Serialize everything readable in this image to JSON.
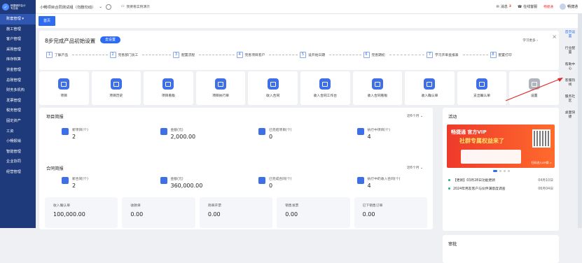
{
  "sidebar": {
    "logo_line1": "畅捷通好会计",
    "logo_line2": "专业版",
    "items": [
      {
        "label": "账套管理 ▾",
        "active": true
      },
      {
        "label": "施工管理",
        "active": false
      },
      {
        "label": "客户管理",
        "active": false
      },
      {
        "label": "采购管理",
        "active": false
      },
      {
        "label": "库存核算",
        "active": false
      },
      {
        "label": "资金管理",
        "active": false
      },
      {
        "label": "总账管理",
        "active": false
      },
      {
        "label": "财务多机构",
        "active": false
      },
      {
        "label": "发票管理",
        "active": false
      },
      {
        "label": "税务管理",
        "active": false
      },
      {
        "label": "固定资产",
        "active": false
      },
      {
        "label": "工资",
        "active": false
      },
      {
        "label": "小畅报销",
        "active": false
      },
      {
        "label": "智能管理",
        "active": false
      },
      {
        "label": "企业协同",
        "active": false
      },
      {
        "label": "经营管理",
        "active": false
      }
    ]
  },
  "topbar": {
    "company": "小畅项目合同测试组（勿删勿动）",
    "demo": "我要看实例演示",
    "message": "消息",
    "message_count": "3",
    "service": "在线客服",
    "brand": "畅捷通",
    "user": "畅捷通"
  },
  "tabs": [
    {
      "label": "首页"
    }
  ],
  "setup": {
    "title": "8步完成产品初始设置",
    "button": "去设置",
    "more": "学习更多 ›",
    "steps": [
      {
        "num": "1",
        "label": "了解产品"
      },
      {
        "num": "2",
        "label": "完善部门员工"
      },
      {
        "num": "3",
        "label": "配置流程"
      },
      {
        "num": "4",
        "label": "完善项目客户"
      },
      {
        "num": "5",
        "label": "设开始日期"
      },
      {
        "num": "6",
        "label": "完善期初"
      },
      {
        "num": "7",
        "label": "学习开单查报表"
      },
      {
        "num": "8",
        "label": "配置打印"
      }
    ]
  },
  "shortcuts": [
    {
      "label": "项目",
      "icon": "project-icon"
    },
    {
      "label": "项目历史",
      "icon": "project-history-icon"
    },
    {
      "label": "项目看板",
      "icon": "project-board-icon"
    },
    {
      "label": "项目执行单",
      "icon": "project-exec-icon"
    },
    {
      "label": "收入合同",
      "icon": "income-contract-icon"
    },
    {
      "label": "收入合同工作台",
      "icon": "contract-desk-icon"
    },
    {
      "label": "收入合同看板",
      "icon": "contract-board-icon"
    },
    {
      "label": "收入确认单",
      "icon": "income-confirm-icon"
    },
    {
      "label": "支出确认单",
      "icon": "expense-confirm-icon"
    },
    {
      "label": "设置",
      "icon": "settings-icon"
    }
  ],
  "project": {
    "title": "项目简报",
    "filter": "近6个月 ⌄",
    "stats": [
      {
        "label": "新项目(个)",
        "value": "2"
      },
      {
        "label": "金额(元)",
        "value": "2,000.00"
      },
      {
        "label": "已完结项目(个)",
        "value": "0"
      },
      {
        "label": "执行中项目(个)",
        "value": "4"
      }
    ]
  },
  "contract": {
    "title": "合同简报",
    "filter": "近6个月 ⌄",
    "stats": [
      {
        "label": "新合同(个)",
        "value": "2"
      },
      {
        "label": "金额(元)",
        "value": "360,000.00"
      },
      {
        "label": "已完成合同(个)",
        "value": "0"
      },
      {
        "label": "执行中的收入合同(个)",
        "value": "4"
      }
    ],
    "minis": [
      {
        "label": "收入确认单",
        "value": "100,000.00"
      },
      {
        "label": "收款单",
        "value": "0.00"
      },
      {
        "label": "简单开票",
        "value": "0.00"
      },
      {
        "label": "销售发票",
        "value": "0.00"
      },
      {
        "label": "已下销售订单",
        "value": "0.00"
      }
    ]
  },
  "activity": {
    "title": "活动",
    "banner_line1": "畅捷通 官方VIP",
    "banner_line2": "社群专属权益来了",
    "banner_footer": "扫码进入VIP群 >",
    "news": [
      {
        "text": "【更新】03月28日功能更新",
        "date": "04月10日"
      },
      {
        "text": "2024年用友客户与伙伴满意度调查",
        "date": "06月04日"
      }
    ]
  },
  "approval": {
    "title": "审批"
  },
  "floatbar": [
    {
      "label": "首页设置",
      "color": "blue"
    },
    {
      "label": "行业配置",
      "color": "dark"
    },
    {
      "label": "帮助中心",
      "color": "dark"
    },
    {
      "label": "客服热线",
      "color": "dark"
    },
    {
      "label": "服务社区",
      "color": "dark"
    },
    {
      "label": "桌面快捷",
      "color": "dark"
    }
  ]
}
